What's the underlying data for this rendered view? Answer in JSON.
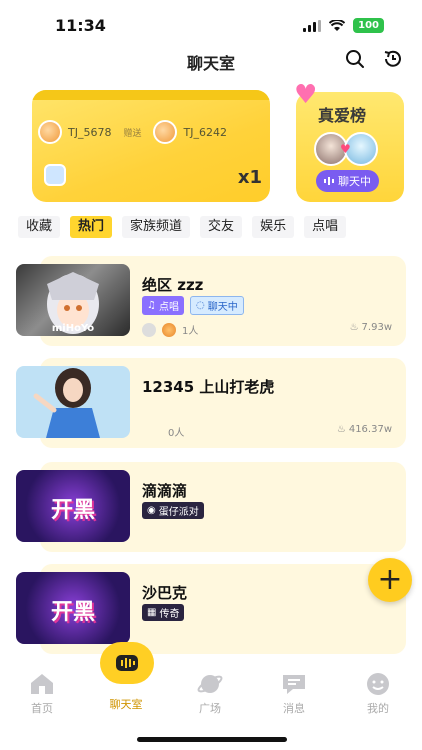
{
  "status_bar": {
    "time": "11:34",
    "battery": "100"
  },
  "header": {
    "title": "聊天室"
  },
  "gift_banner": {
    "sender": "TJ_5678",
    "verb": "赠送",
    "receiver": "TJ_6242",
    "count": "x1"
  },
  "love_banner": {
    "title": "真爱榜",
    "pill": "聊天中"
  },
  "tabs": [
    {
      "label": "收藏"
    },
    {
      "label": "热门"
    },
    {
      "label": "家族频道"
    },
    {
      "label": "交友"
    },
    {
      "label": "娱乐"
    },
    {
      "label": "点唱"
    }
  ],
  "rooms": [
    {
      "name": "绝区 zzz",
      "tags": [
        "点唱",
        "聊天中"
      ],
      "members": "1人",
      "heat": "7.93w",
      "thumb_text": "miHoYo"
    },
    {
      "name": "12345 上山打老虎",
      "members": "0人",
      "heat": "416.37w"
    },
    {
      "name": "滴滴滴",
      "tags": [
        "蛋仔派对"
      ],
      "thumb_text": "开黑"
    },
    {
      "name": "沙巴克",
      "tags": [
        "传奇"
      ],
      "thumb_text": "开黑"
    }
  ],
  "tabbar": [
    {
      "label": "首页"
    },
    {
      "label": "聊天室"
    },
    {
      "label": "广场"
    },
    {
      "label": "消息"
    },
    {
      "label": "我的"
    }
  ],
  "colors": {
    "accent": "#ffd52e",
    "purple": "#8a70ff"
  }
}
